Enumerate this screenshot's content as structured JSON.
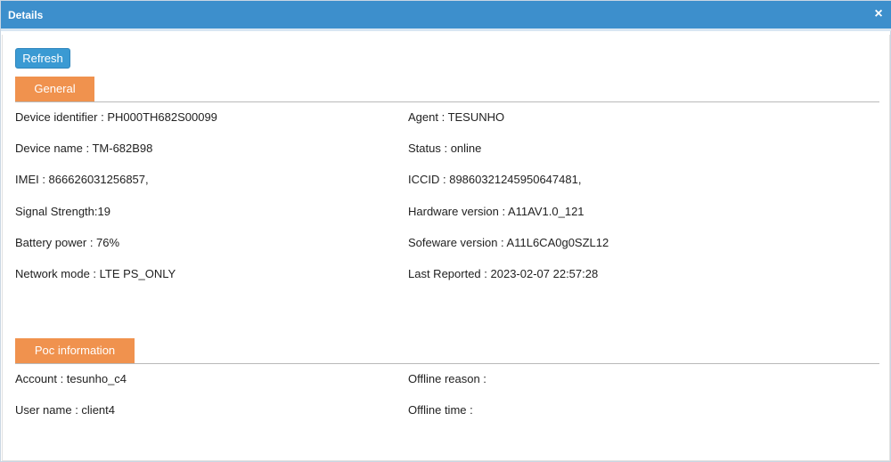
{
  "dialog": {
    "title": "Details",
    "close_glyph": "×",
    "close_icon": "close-icon"
  },
  "toolbar": {
    "refresh_label": "Refresh"
  },
  "general": {
    "tab_label": "General",
    "left": [
      "Device identifier : PH000TH682S00099",
      "Device name : TM-682B98",
      "IMEI : 866626031256857,",
      "Signal Strength:19",
      "Battery power : 76%",
      "Network mode : LTE PS_ONLY"
    ],
    "right": [
      "Agent : TESUNHO",
      "Status : online",
      "ICCID : 89860321245950647481,",
      "Hardware version : A11AV1.0_121",
      "Sofeware version : A11L6CA0g0SZL12",
      "Last Reported : 2023-02-07 22:57:28"
    ]
  },
  "poc": {
    "tab_label": "Poc information",
    "left": [
      "Account : tesunho_c4",
      "User name : client4"
    ],
    "right": [
      "Offline reason :",
      "Offline time :"
    ]
  },
  "colors": {
    "titlebar": "#3d8fcc",
    "tab": "#f0924e",
    "button": "#3a9ad3"
  }
}
